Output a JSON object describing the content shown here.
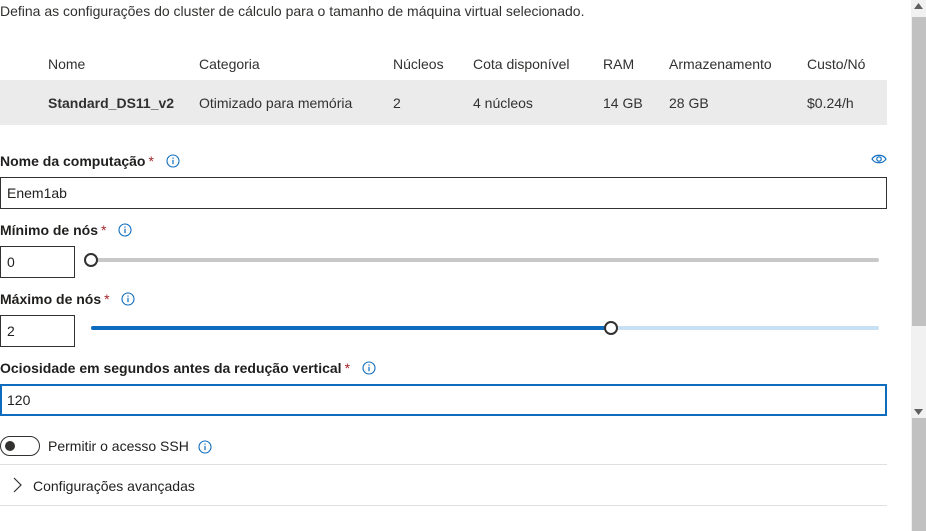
{
  "description": "Defina as configurações do cluster de cálculo para o tamanho de máquina virtual selecionado.",
  "table": {
    "headers": {
      "nome": "Nome",
      "categoria": "Categoria",
      "nucleos": "Núcleos",
      "cota": "Cota disponível",
      "ram": "RAM",
      "armazenamento": "Armazenamento",
      "custo": "Custo/Nó"
    },
    "row": {
      "nome": "Standard_DS11_v2",
      "categoria": "Otimizado para memória",
      "nucleos": "2",
      "cota": "4 núcleos",
      "ram": "14 GB",
      "armazenamento": "28 GB",
      "custo": "$0.24/h"
    }
  },
  "compute_name": {
    "label": "Nome da computação",
    "required": "*",
    "value": "Enem1ab"
  },
  "min_nodes": {
    "label": "Mínimo de nós",
    "required": "*",
    "value": "0",
    "slider_fraction": 0.0
  },
  "max_nodes": {
    "label": "Máximo de nós",
    "required": "*",
    "value": "2",
    "slider_fraction": 0.66
  },
  "idle": {
    "label": "Ociosidade em segundos antes da redução vertical",
    "required": "*",
    "value": "120"
  },
  "ssh": {
    "label": "Permitir o acesso SSH",
    "enabled": false
  },
  "advanced": {
    "label": "Configurações avançadas"
  },
  "colors": {
    "accent": "#0f6cbd",
    "required": "#a4262c",
    "row_bg": "#ebebeb"
  },
  "icons": [
    "info-icon",
    "eye-icon",
    "chevron-right-icon"
  ]
}
